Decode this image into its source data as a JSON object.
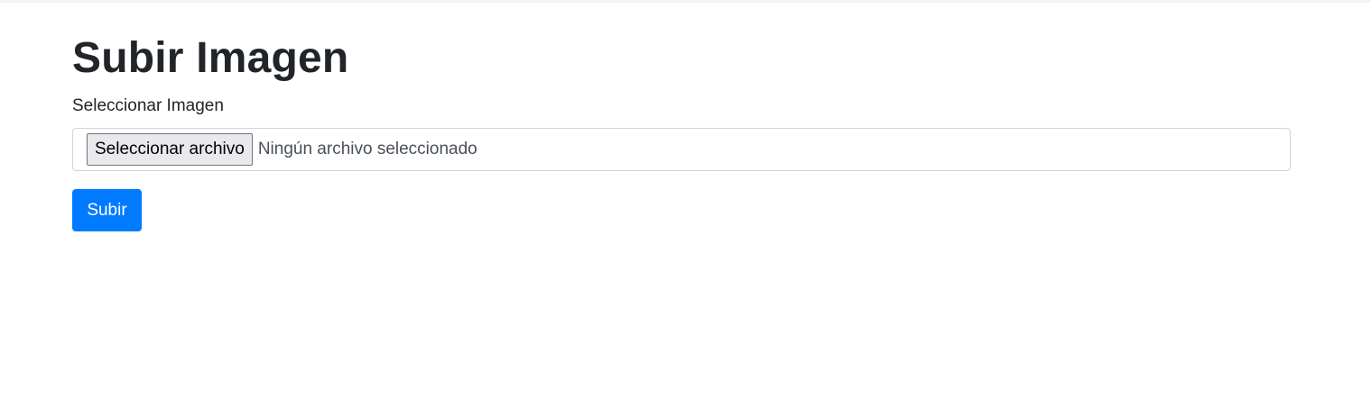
{
  "page": {
    "title": "Subir Imagen"
  },
  "form": {
    "file_label": "Seleccionar Imagen",
    "file_button_label": "Seleccionar archivo",
    "file_status": "Ningún archivo seleccionado",
    "submit_label": "Subir"
  },
  "colors": {
    "primary": "#007bff",
    "text": "#212529",
    "input_border": "#ced4da"
  }
}
